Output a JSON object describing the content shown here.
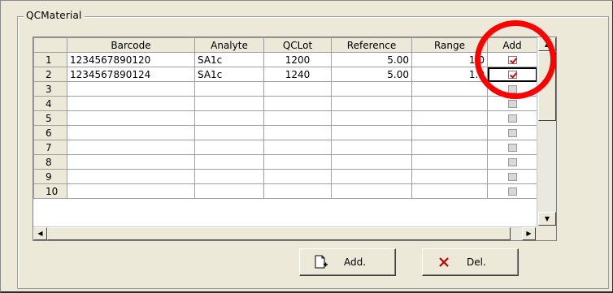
{
  "group": {
    "title": "QCMaterial"
  },
  "grid": {
    "columns": [
      "Barcode",
      "Analyte",
      "QCLot",
      "Reference",
      "Range",
      "Add"
    ],
    "rows": [
      {
        "num": "1",
        "barcode": "1234567890120",
        "analyte": "SA1c",
        "qclot": "1200",
        "reference": "5.00",
        "range": "1.0",
        "add": true
      },
      {
        "num": "2",
        "barcode": "1234567890124",
        "analyte": "SA1c",
        "qclot": "1240",
        "reference": "5.00",
        "range": "1.0",
        "add": true
      },
      {
        "num": "3",
        "barcode": "",
        "analyte": "",
        "qclot": "",
        "reference": "",
        "range": "",
        "add": false
      },
      {
        "num": "4",
        "barcode": "",
        "analyte": "",
        "qclot": "",
        "reference": "",
        "range": "",
        "add": false
      },
      {
        "num": "5",
        "barcode": "",
        "analyte": "",
        "qclot": "",
        "reference": "",
        "range": "",
        "add": false
      },
      {
        "num": "6",
        "barcode": "",
        "analyte": "",
        "qclot": "",
        "reference": "",
        "range": "",
        "add": false
      },
      {
        "num": "7",
        "barcode": "",
        "analyte": "",
        "qclot": "",
        "reference": "",
        "range": "",
        "add": false
      },
      {
        "num": "8",
        "barcode": "",
        "analyte": "",
        "qclot": "",
        "reference": "",
        "range": "",
        "add": false
      },
      {
        "num": "9",
        "barcode": "",
        "analyte": "",
        "qclot": "",
        "reference": "",
        "range": "",
        "add": false
      },
      {
        "num": "10",
        "barcode": "",
        "analyte": "",
        "qclot": "",
        "reference": "",
        "range": "",
        "add": false
      }
    ]
  },
  "buttons": {
    "add": {
      "label": "Add.",
      "icon": "new-document-icon"
    },
    "del": {
      "label": "Del.",
      "icon": "delete-x-icon"
    }
  },
  "colors": {
    "highlight_circle": "#ff0000",
    "check": "#e00000"
  }
}
